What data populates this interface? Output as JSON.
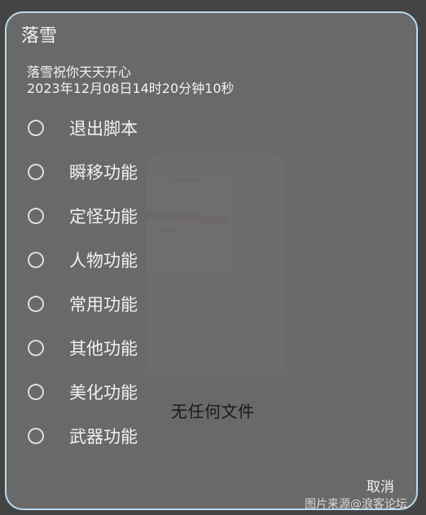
{
  "dialog": {
    "title": "落雪",
    "greeting": "落雪祝你天天开心",
    "datetime": "2023年12月08日14时20分钟10秒",
    "options": [
      {
        "label": "退出脚本"
      },
      {
        "label": "瞬移功能"
      },
      {
        "label": "定怪功能"
      },
      {
        "label": "人物功能"
      },
      {
        "label": "常用功能"
      },
      {
        "label": "其他功能"
      },
      {
        "label": "美化功能"
      },
      {
        "label": "武器功能"
      }
    ],
    "cancel_label": "取消"
  },
  "background": {
    "empty_text": "无任何文件",
    "accent_color": "#b9d9ee"
  },
  "watermark": "图片来源@浪客论坛"
}
